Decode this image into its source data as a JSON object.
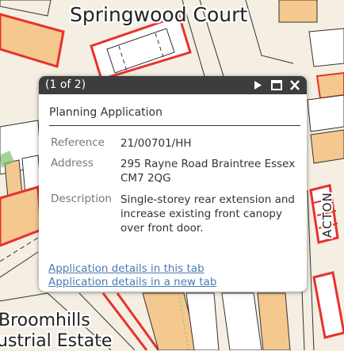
{
  "map": {
    "labels": {
      "court": "Springwood Court",
      "broomhills": "Broomhills",
      "estate": "ustrial Estate",
      "road": "ACTON"
    },
    "colors": {
      "background": "#f4efe2",
      "building": "#f4c88e",
      "outline": "#333333",
      "highlight": "#e8312e",
      "path_green": "#7fbf6e"
    }
  },
  "popup": {
    "count": "(1 of 2)",
    "title": "Planning Application",
    "fields": [
      {
        "label": "Reference",
        "value": "21/00701/HH"
      },
      {
        "label": "Address",
        "value": "295 Rayne Road Braintree Essex CM7 2QG"
      },
      {
        "label": "Description",
        "value": "Single-storey rear extension and increase existing front canopy over front door."
      }
    ],
    "links": [
      "Application details in this tab",
      "Application details in a new tab"
    ],
    "icons": [
      "next-icon",
      "maximize-icon",
      "close-icon"
    ],
    "header_color": "#3d3d3d",
    "link_color": "#4a7bb5"
  }
}
